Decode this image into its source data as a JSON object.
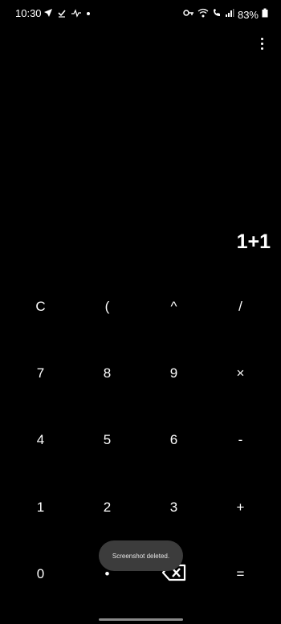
{
  "status_bar": {
    "time": "10:30",
    "battery": "83%",
    "left_icons": [
      "navigation-arrow-icon",
      "check-notification-icon",
      "wifi-calling-icon",
      "dot-icon"
    ],
    "right_icons": [
      "vpn-key-icon",
      "wifi-icon",
      "wifi-call-icon",
      "signal-icon",
      "battery-icon"
    ]
  },
  "display": {
    "expression": "1+1"
  },
  "keypad": {
    "rows": [
      [
        {
          "label": "C",
          "name": "clear-key"
        },
        {
          "label": "(",
          "name": "open-paren-key"
        },
        {
          "label": "^",
          "name": "power-key"
        },
        {
          "label": "/",
          "name": "divide-key"
        }
      ],
      [
        {
          "label": "7",
          "name": "digit-7-key"
        },
        {
          "label": "8",
          "name": "digit-8-key"
        },
        {
          "label": "9",
          "name": "digit-9-key"
        },
        {
          "label": "×",
          "name": "multiply-key"
        }
      ],
      [
        {
          "label": "4",
          "name": "digit-4-key"
        },
        {
          "label": "5",
          "name": "digit-5-key"
        },
        {
          "label": "6",
          "name": "digit-6-key"
        },
        {
          "label": "-",
          "name": "subtract-key"
        }
      ],
      [
        {
          "label": "1",
          "name": "digit-1-key"
        },
        {
          "label": "2",
          "name": "digit-2-key"
        },
        {
          "label": "3",
          "name": "digit-3-key"
        },
        {
          "label": "+",
          "name": "add-key"
        }
      ],
      [
        {
          "label": "0",
          "name": "digit-0-key"
        },
        {
          "label": "•",
          "name": "decimal-key"
        },
        {
          "label": "",
          "name": "backspace-key",
          "icon": "backspace-icon"
        },
        {
          "label": "=",
          "name": "equals-key"
        }
      ]
    ]
  },
  "toast": {
    "message": "Screenshot deleted."
  },
  "colors": {
    "background": "#000000",
    "text": "#ffffff",
    "toast_bg": "#3c3c3c"
  }
}
